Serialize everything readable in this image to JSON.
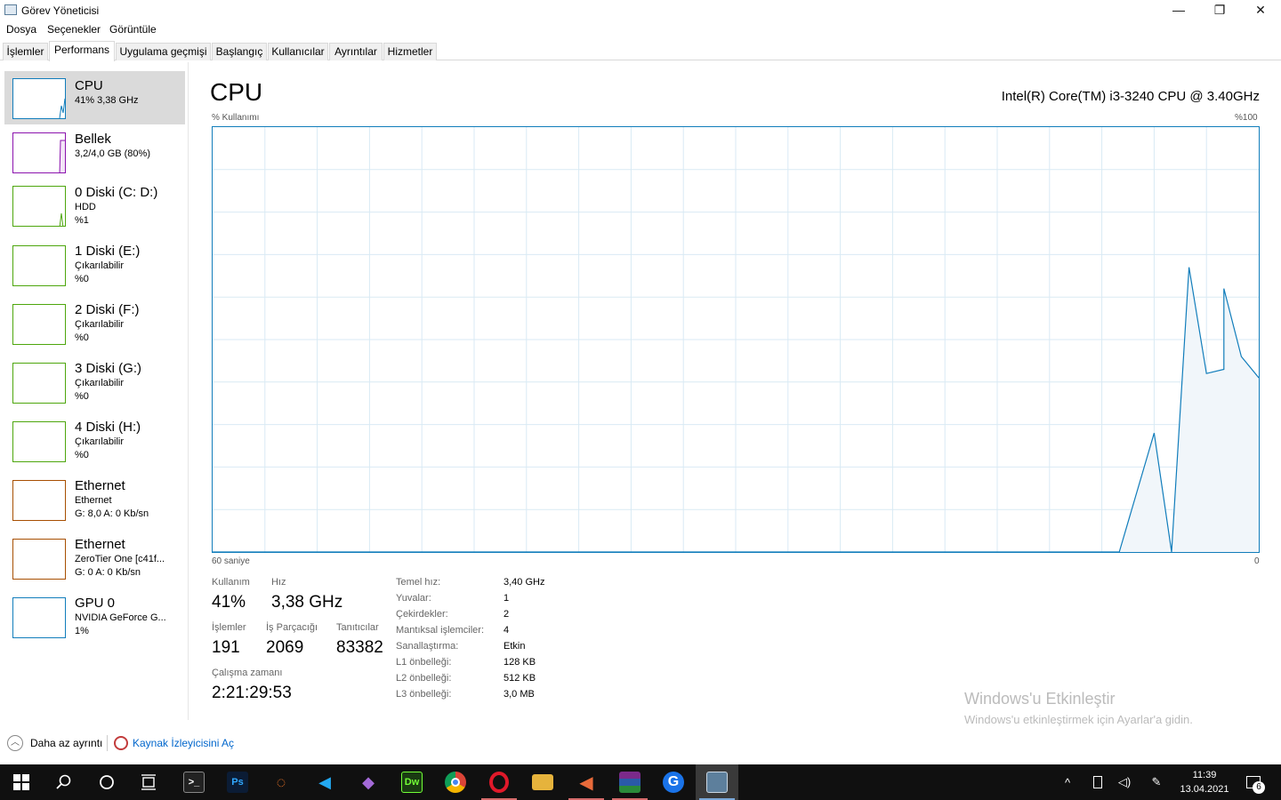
{
  "window": {
    "title": "Görev Yöneticisi",
    "min": "—",
    "max": "❐",
    "close": "✕"
  },
  "menu": [
    "Dosya",
    "Seçenekler",
    "Görüntüle"
  ],
  "tabs": [
    "İşlemler",
    "Performans",
    "Uygulama geçmişi",
    "Başlangıç",
    "Kullanıcılar",
    "Ayrıntılar",
    "Hizmetler"
  ],
  "active_tab": "Performans",
  "sidebar": [
    {
      "title": "CPU",
      "sub1": "41% 3,38 GHz",
      "sub2": "",
      "color": "#117dbb",
      "selected": true
    },
    {
      "title": "Bellek",
      "sub1": "3,2/4,0 GB (80%)",
      "sub2": "",
      "color": "#8b12ae"
    },
    {
      "title": "0 Diski (C: D:)",
      "sub1": "HDD",
      "sub2": "%1",
      "color": "#4da60c"
    },
    {
      "title": "1 Diski (E:)",
      "sub1": "Çıkarılabilir",
      "sub2": "%0",
      "color": "#4da60c"
    },
    {
      "title": "2 Diski (F:)",
      "sub1": "Çıkarılabilir",
      "sub2": "%0",
      "color": "#4da60c"
    },
    {
      "title": "3 Diski (G:)",
      "sub1": "Çıkarılabilir",
      "sub2": "%0",
      "color": "#4da60c"
    },
    {
      "title": "4 Diski (H:)",
      "sub1": "Çıkarılabilir",
      "sub2": "%0",
      "color": "#4da60c"
    },
    {
      "title": "Ethernet",
      "sub1": "Ethernet",
      "sub2": "G: 8,0 A: 0 Kb/sn",
      "color": "#a74f01"
    },
    {
      "title": "Ethernet",
      "sub1": "ZeroTier One [c41f...",
      "sub2": "G: 0 A: 0 Kb/sn",
      "color": "#a74f01"
    },
    {
      "title": "GPU 0",
      "sub1": "NVIDIA GeForce G...",
      "sub2": "1%",
      "color": "#117dbb"
    }
  ],
  "main": {
    "title": "CPU",
    "cpu_name": "Intel(R) Core(TM) i3-3240 CPU @ 3.40GHz",
    "usage_label": "% Kullanımı",
    "max_label": "%100",
    "time_label": "60 saniye",
    "zero_label": "0"
  },
  "stats": {
    "usage_lbl": "Kullanım",
    "usage_val": "41%",
    "speed_lbl": "Hız",
    "speed_val": "3,38 GHz",
    "proc_lbl": "İşlemler",
    "proc_val": "191",
    "thread_lbl": "İş Parçacığı",
    "thread_val": "2069",
    "handle_lbl": "Tanıtıcılar",
    "handle_val": "83382",
    "uptime_lbl": "Çalışma zamanı",
    "uptime_val": "2:21:29:53"
  },
  "specs": [
    {
      "label": "Temel hız:",
      "value": "3,40 GHz"
    },
    {
      "label": "Yuvalar:",
      "value": "1"
    },
    {
      "label": "Çekirdekler:",
      "value": "2"
    },
    {
      "label": "Mantıksal işlemciler:",
      "value": "4"
    },
    {
      "label": "Sanallaştırma:",
      "value": "Etkin"
    },
    {
      "label": "L1 önbelleği:",
      "value": "128 KB"
    },
    {
      "label": "L2 önbelleği:",
      "value": "512 KB"
    },
    {
      "label": "L3 önbelleği:",
      "value": "3,0 MB"
    }
  ],
  "watermark": {
    "line1": "Windows'u Etkinleştir",
    "line2": "Windows'u etkinleştirmek için Ayarlar'a gidin."
  },
  "footer": {
    "less": "Daha az ayrıntı",
    "resmon": "Kaynak İzleyicisini Aç"
  },
  "chart_data": {
    "type": "area",
    "xlabel": "60 saniye",
    "ylabel": "% Kullanımı",
    "ylim": [
      0,
      100
    ],
    "x": [
      0,
      2,
      4,
      6,
      8,
      10,
      12,
      14,
      16,
      18,
      20,
      22,
      24,
      26,
      28,
      30,
      32,
      34,
      36,
      38,
      40,
      42,
      44,
      46,
      48,
      50,
      52,
      54,
      56,
      58,
      60
    ],
    "values": [
      0,
      0,
      0,
      0,
      0,
      0,
      0,
      0,
      0,
      0,
      0,
      0,
      0,
      0,
      0,
      0,
      0,
      0,
      0,
      0,
      0,
      0,
      0,
      0,
      0,
      0,
      0,
      28,
      67,
      43,
      41
    ],
    "extra_points": [
      [
        55,
        0
      ],
      [
        57,
        42
      ],
      [
        58,
        62
      ],
      [
        59,
        46
      ]
    ],
    "color": "#117dbb",
    "grid": true
  },
  "taskbar": {
    "apps": [
      {
        "name": "cmd",
        "glyph": ">_",
        "color": "#222"
      },
      {
        "name": "photoshop",
        "glyph": "Ps",
        "color": "#0b1c35"
      },
      {
        "name": "jupyter",
        "glyph": "◌",
        "color": "#101010"
      },
      {
        "name": "vscode",
        "glyph": "◀",
        "color": "#0d6db3"
      },
      {
        "name": "visual-studio",
        "glyph": "◆",
        "color": "#6a2fa3"
      },
      {
        "name": "dreamweaver",
        "glyph": "Dw",
        "color": "#1a3b12"
      },
      {
        "name": "chrome",
        "glyph": "●",
        "color": "#db4437"
      },
      {
        "name": "opera",
        "glyph": "O",
        "color": "#c8102e"
      },
      {
        "name": "explorer",
        "glyph": "▭",
        "color": "#e6b33c"
      },
      {
        "name": "media",
        "glyph": "◀",
        "color": "#d55b2e"
      },
      {
        "name": "winrar",
        "glyph": "▤",
        "color": "#8b2a6b"
      },
      {
        "name": "gmail",
        "glyph": "G",
        "color": "#1a73e8"
      },
      {
        "name": "task-manager",
        "glyph": "▥",
        "color": "#3a5a78"
      }
    ],
    "time": "11:39",
    "date": "13.04.2021",
    "notif_count": "6"
  }
}
